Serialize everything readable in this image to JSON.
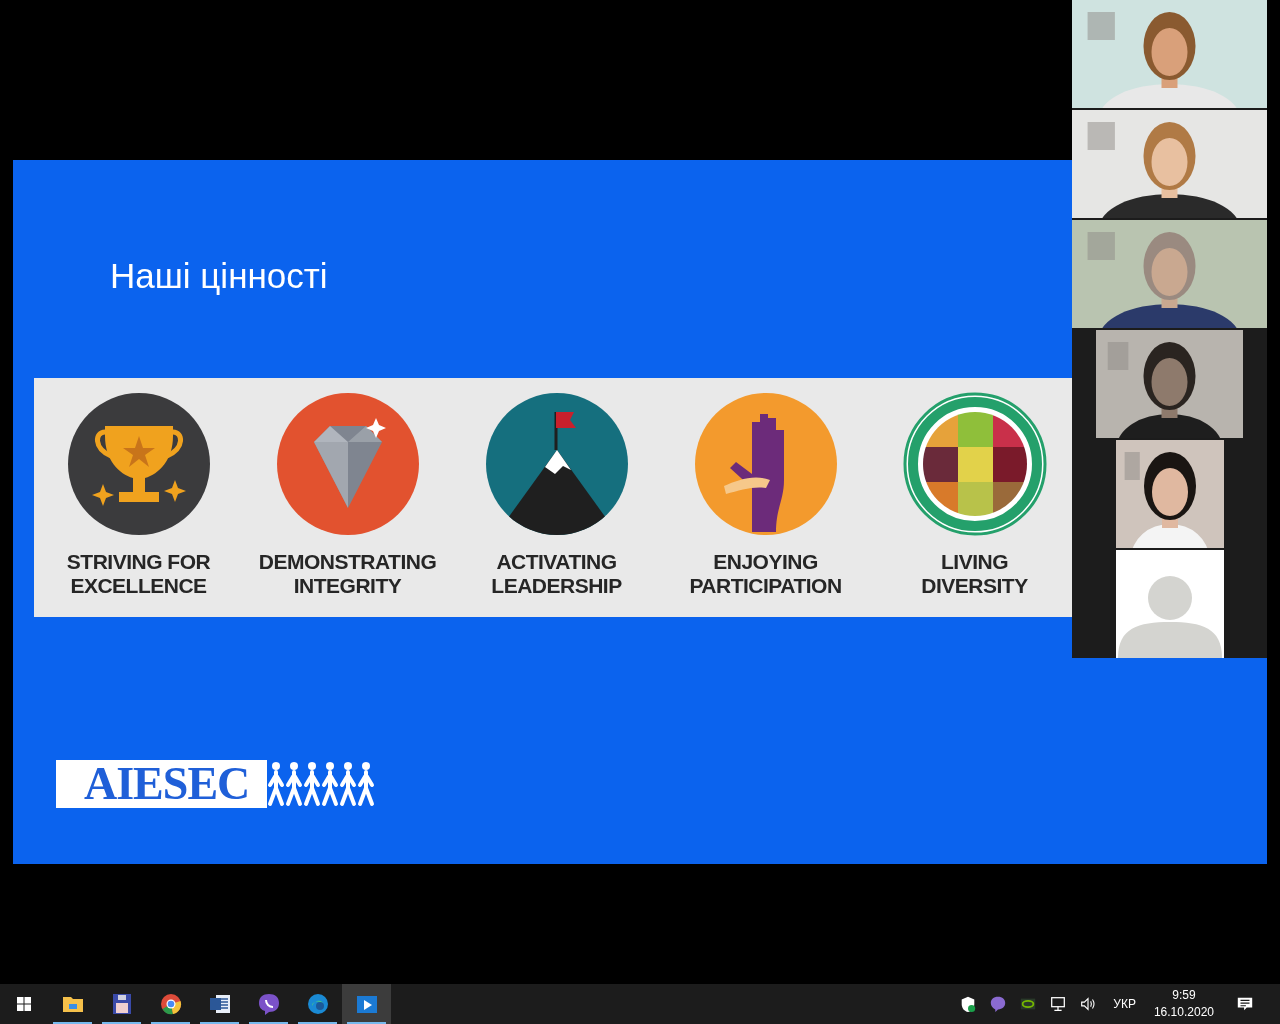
{
  "slide": {
    "title": "Наші цінності",
    "values": [
      {
        "kind": "trophy",
        "label": "STRIVING FOR\nEXCELLENCE"
      },
      {
        "kind": "diamond",
        "label": "DEMONSTRATING\nINTEGRITY"
      },
      {
        "kind": "mountain",
        "label": "ACTIVATING\nLEADERSHIP"
      },
      {
        "kind": "hand",
        "label": "ENJOYING\nPARTICIPATION"
      },
      {
        "kind": "globe",
        "label": "LIVING\nDIVERSITY"
      }
    ],
    "logo": {
      "text": "AIESEC"
    }
  },
  "participants": [
    {
      "kind": "picture"
    },
    {
      "kind": "picture"
    },
    {
      "kind": "picture"
    },
    {
      "kind": "picture"
    },
    {
      "kind": "picture"
    },
    {
      "kind": "avatar"
    }
  ],
  "taskbar": {
    "apps": [
      {
        "kind": "folder",
        "running": true,
        "selected": false
      },
      {
        "kind": "floppy",
        "running": true,
        "selected": false
      },
      {
        "kind": "browser",
        "running": true,
        "selected": false
      },
      {
        "kind": "document",
        "running": true,
        "selected": false
      },
      {
        "kind": "chat",
        "running": true,
        "selected": false
      },
      {
        "kind": "edge",
        "running": true,
        "selected": false
      },
      {
        "kind": "video",
        "running": true,
        "selected": true
      }
    ],
    "language": "УКР",
    "time": "9:59",
    "date": "16.10.2020"
  }
}
